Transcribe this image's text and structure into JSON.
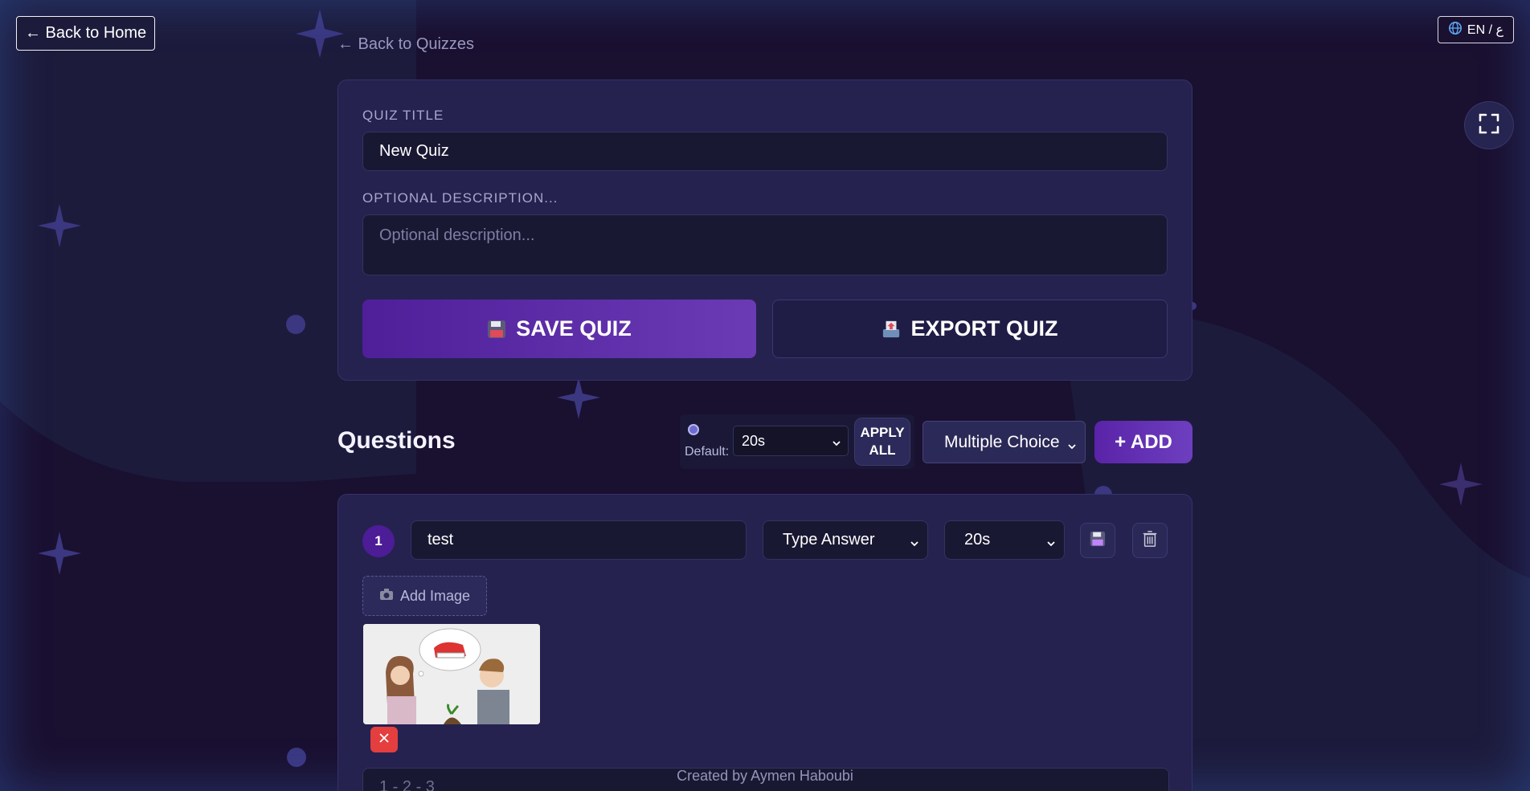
{
  "nav": {
    "back_home": "← Back to Home",
    "back_quizzes": "← Back to Quizzes",
    "lang_toggle": "EN / ع"
  },
  "quiz": {
    "title_label": "QUIZ TITLE",
    "title_value": "New Quiz",
    "description_label": "OPTIONAL DESCRIPTION...",
    "description_placeholder": "Optional description...",
    "save_label": "SAVE QUIZ",
    "export_label": "EXPORT QUIZ"
  },
  "questions": {
    "heading": "Questions",
    "default_label": "Default:",
    "default_time": "20s",
    "apply_all_label": "APPLY ALL",
    "question_type": "Multiple Choice",
    "add_label": "+ ADD",
    "items": [
      {
        "number": "1",
        "text": "test",
        "type": "Type Answer",
        "time": "20s",
        "add_image_label": "Add Image",
        "answer_placeholder": "1 - 2 - 3"
      }
    ]
  },
  "footer": {
    "credit": "Created by Aymen Haboubi"
  },
  "colors": {
    "accent": "#5a23a8",
    "card": "#252250",
    "input": "#191833",
    "danger": "#e53e3e"
  }
}
